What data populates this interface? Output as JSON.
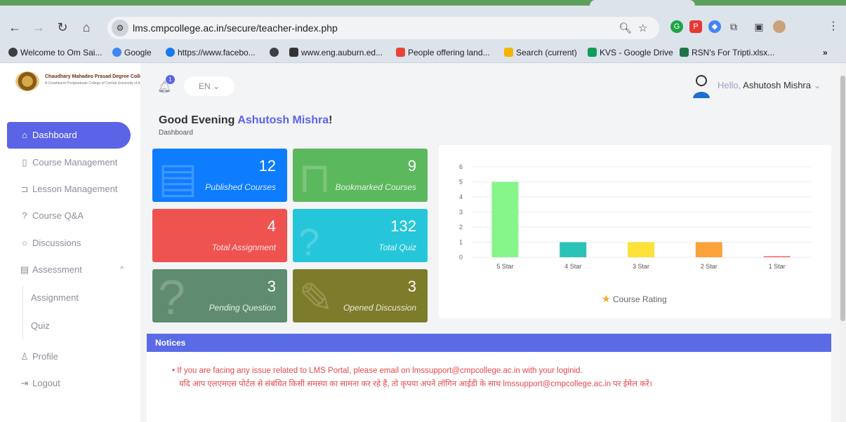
{
  "browser": {
    "url": "lms.cmpcollege.ac.in/secure/teacher-index.php",
    "bookmarks": [
      {
        "label": "Welcome to Om Sai...",
        "color": "#3c4043"
      },
      {
        "label": "Google",
        "color": "#4285f4"
      },
      {
        "label": "https://www.facebo...",
        "color": "#1877f2"
      },
      {
        "label": "",
        "color": "#3c4043"
      },
      {
        "label": "www.eng.auburn.ed...",
        "color": "#333333"
      },
      {
        "label": "People offering land...",
        "color": "#ea4335"
      },
      {
        "label": "Search (current)",
        "color": "#f4b400"
      },
      {
        "label": "KVS - Google Drive",
        "color": "#0f9d58"
      },
      {
        "label": "RSN's For Tripti.xlsx...",
        "color": "#217346"
      }
    ]
  },
  "sidebar": {
    "logo_title": "Chaudhary Mahadeo Prasad Degree College",
    "logo_subtitle": "A Constituent Postgraduate College of Central University of Allahabad",
    "items": [
      {
        "label": "Dashboard",
        "icon": "home-icon"
      },
      {
        "label": "Course Management",
        "icon": "book-icon"
      },
      {
        "label": "Lesson Management",
        "icon": "bookmark-icon"
      },
      {
        "label": "Course Q&A",
        "icon": "question-icon"
      },
      {
        "label": "Discussions",
        "icon": "chat-icon"
      },
      {
        "label": "Assessment",
        "icon": "document-icon"
      },
      {
        "label": "Profile",
        "icon": "user-icon"
      },
      {
        "label": "Logout",
        "icon": "logout-icon"
      }
    ],
    "sub_items": [
      "Assignment",
      "Quiz"
    ]
  },
  "header": {
    "notification_count": "1",
    "language": "EN",
    "hello_prefix": "Hello,",
    "user_name": "Ashutosh Mishra"
  },
  "greeting": {
    "prefix": "Good Evening",
    "name": "Ashutosh Mishra",
    "suffix": "!",
    "breadcrumb": "Dashboard"
  },
  "stats": [
    {
      "value": "12",
      "label": "Published Courses",
      "color": "#0d7cff"
    },
    {
      "value": "9",
      "label": "Bookmarked Courses",
      "color": "#5cb85c"
    },
    {
      "value": "4",
      "label": "Total Assignment",
      "color": "#ef5350"
    },
    {
      "value": "132",
      "label": "Total Quiz",
      "color": "#26c6da"
    },
    {
      "value": "3",
      "label": "Pending Question",
      "color": "#5f8c71"
    },
    {
      "value": "3",
      "label": "Opened Discussion",
      "color": "#7c7c2a"
    }
  ],
  "chart_data": {
    "type": "bar",
    "categories": [
      "5 Star",
      "4 Star",
      "3 Star",
      "2 Star",
      "1 Star"
    ],
    "values": [
      5,
      1,
      1,
      1,
      0
    ],
    "colors": [
      "#86f58a",
      "#2cc3b7",
      "#fde23a",
      "#fba23a",
      "#e66"
    ],
    "ylim": [
      0,
      6
    ],
    "yticks": [
      0,
      1,
      2,
      3,
      4,
      5,
      6
    ],
    "legend": "Course Rating",
    "legend_placement": "bottom",
    "grid": true
  },
  "notices": {
    "title": "Notices",
    "line_en": "If you are facing any issue related to LMS Portal, please email on lmssupport@cmpcollege.ac.in with your loginid.",
    "line_hi": "यदि आप एलएमएस पोर्टल से संबंधित किसी समस्या का सामना कर रहे हैं, तो कृपया अपने लॉगिन आईडी के साथ lmssupport@cmpcollege.ac.in पर ईमेल करें।"
  }
}
